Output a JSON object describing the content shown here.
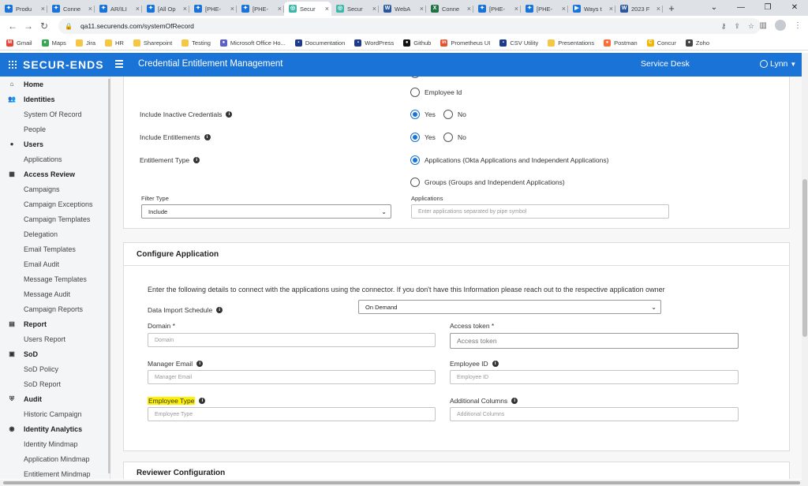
{
  "browser": {
    "tabs": [
      {
        "title": "Produ",
        "color": "#1a73d6",
        "glyph": "✦",
        "icon": "jira-icon"
      },
      {
        "title": "Conne",
        "color": "#1a73d6",
        "glyph": "✦",
        "icon": "jira-icon"
      },
      {
        "title": "AR/ILI",
        "color": "#1a73d6",
        "glyph": "✦",
        "icon": "jira-icon"
      },
      {
        "title": "[All Op",
        "color": "#1a73d6",
        "glyph": "✦",
        "icon": "jira-icon"
      },
      {
        "title": "[PHE-",
        "color": "#1a73d6",
        "glyph": "✦",
        "icon": "jira-icon"
      },
      {
        "title": "[PHE-",
        "color": "#1a73d6",
        "glyph": "✦",
        "icon": "jira-icon"
      },
      {
        "title": "Secur",
        "color": "#3fb6a8",
        "glyph": "◎",
        "icon": "securends-icon",
        "active": true
      },
      {
        "title": "Secur",
        "color": "#3fb6a8",
        "glyph": "◎",
        "icon": "securends-icon"
      },
      {
        "title": "WebA",
        "color": "#2b579a",
        "glyph": "W",
        "icon": "word-icon"
      },
      {
        "title": "Conne",
        "color": "#217346",
        "glyph": "X",
        "icon": "excel-icon"
      },
      {
        "title": "[PHE-",
        "color": "#1a73d6",
        "glyph": "✦",
        "icon": "jira-icon"
      },
      {
        "title": "[PHE-",
        "color": "#1a73d6",
        "glyph": "✦",
        "icon": "jira-icon"
      },
      {
        "title": "Ways t",
        "color": "#1a73d6",
        "glyph": "▶",
        "icon": "play-icon"
      },
      {
        "title": "2023 F",
        "color": "#2b579a",
        "glyph": "W",
        "icon": "word-icon"
      }
    ],
    "url": "qa11.securends.com/systemOfRecord",
    "bookmarks": [
      {
        "label": "Gmail",
        "color": "#ea4335",
        "glyph": "M",
        "icon": "gmail-icon"
      },
      {
        "label": "Maps",
        "color": "#34a853",
        "glyph": "●",
        "icon": "maps-icon"
      },
      {
        "label": "Jira",
        "color": "#f6c744",
        "glyph": "",
        "icon": "folder-icon"
      },
      {
        "label": "HR",
        "color": "#f6c744",
        "glyph": "",
        "icon": "folder-icon"
      },
      {
        "label": "Sharepoint",
        "color": "#f6c744",
        "glyph": "",
        "icon": "folder-icon"
      },
      {
        "label": "Testing",
        "color": "#f6c744",
        "glyph": "",
        "icon": "folder-icon"
      },
      {
        "label": "Microsoft Office Ho...",
        "color": "#5b5fc7",
        "glyph": "●",
        "icon": "office-icon"
      },
      {
        "label": "Documentation",
        "color": "#1e3a8a",
        "glyph": "▪",
        "icon": "doc-icon"
      },
      {
        "label": "WordPress",
        "color": "#1e3a8a",
        "glyph": "▪",
        "icon": "wordpress-icon"
      },
      {
        "label": "Github",
        "color": "#111111",
        "glyph": "●",
        "icon": "github-icon"
      },
      {
        "label": "Prometheus UI",
        "color": "#e6522c",
        "glyph": "in",
        "icon": "prometheus-icon"
      },
      {
        "label": "CSV Utility",
        "color": "#1e3a8a",
        "glyph": "▪",
        "icon": "csv-icon"
      },
      {
        "label": "Presentations",
        "color": "#f6c744",
        "glyph": "",
        "icon": "folder-icon"
      },
      {
        "label": "Postman",
        "color": "#ff6c37",
        "glyph": "●",
        "icon": "postman-icon"
      },
      {
        "label": "Concur",
        "color": "#f2b705",
        "glyph": "C",
        "icon": "concur-icon"
      },
      {
        "label": "Zoho",
        "color": "#444444",
        "glyph": "●",
        "icon": "zoho-icon"
      }
    ]
  },
  "header": {
    "brand": "SECUR-ENDS",
    "title": "Credential Entitlement Management",
    "service_desk": "Service Desk",
    "user": "Lynn"
  },
  "sidebar": {
    "items": [
      {
        "label": "Home",
        "type": "section",
        "icon": "home-icon",
        "glyph": "⌂"
      },
      {
        "label": "Identities",
        "type": "section",
        "icon": "identities-icon",
        "glyph": "👥"
      },
      {
        "label": "System Of Record",
        "type": "child"
      },
      {
        "label": "People",
        "type": "child"
      },
      {
        "label": "Users",
        "type": "section",
        "icon": "user-icon",
        "glyph": "●"
      },
      {
        "label": "Applications",
        "type": "child"
      },
      {
        "label": "Access Review",
        "type": "section",
        "icon": "grid-icon",
        "glyph": "▦"
      },
      {
        "label": "Campaigns",
        "type": "child"
      },
      {
        "label": "Campaign Exceptions",
        "type": "child"
      },
      {
        "label": "Campaign Templates",
        "type": "child"
      },
      {
        "label": "Delegation",
        "type": "child"
      },
      {
        "label": "Email Templates",
        "type": "child"
      },
      {
        "label": "Email Audit",
        "type": "child"
      },
      {
        "label": "Message Templates",
        "type": "child"
      },
      {
        "label": "Message Audit",
        "type": "child"
      },
      {
        "label": "Campaign Reports",
        "type": "child"
      },
      {
        "label": "Report",
        "type": "section",
        "icon": "report-icon",
        "glyph": "▤"
      },
      {
        "label": "Users Report",
        "type": "child"
      },
      {
        "label": "SoD",
        "type": "section",
        "icon": "sod-icon",
        "glyph": "▣"
      },
      {
        "label": "SoD Policy",
        "type": "child"
      },
      {
        "label": "SoD Report",
        "type": "child"
      },
      {
        "label": "Audit",
        "type": "section",
        "icon": "shield-icon",
        "glyph": "⛨"
      },
      {
        "label": "Historic Campaign",
        "type": "child"
      },
      {
        "label": "Identity Analytics",
        "type": "section",
        "icon": "analytics-icon",
        "glyph": "◉"
      },
      {
        "label": "Identity Mindmap",
        "type": "child"
      },
      {
        "label": "Application Mindmap",
        "type": "child"
      },
      {
        "label": "Entitlement Mindmap",
        "type": "child"
      }
    ]
  },
  "options": {
    "employee_id": "Employee Id",
    "inactive_label": "Include Inactive Credentials",
    "entitlements_label": "Include Entitlements",
    "entitlement_type_label": "Entitlement Type",
    "yes": "Yes",
    "no": "No",
    "ent_apps": "Applications (Okta Applications and Independent Applications)",
    "ent_groups": "Groups (Groups and Independent Applications)",
    "filter_type_label": "Filter Type",
    "filter_type_value": "Include",
    "applications_label": "Applications",
    "applications_placeholder": "Enter applications separated by pipe symbol"
  },
  "configure": {
    "title": "Configure Application",
    "intro": "Enter the following details to connect with the applications using the connector. If you don't have this Information please reach out to the respective application owner",
    "schedule_label": "Data Import Schedule",
    "schedule_value": "On Demand",
    "domain_label": "Domain *",
    "domain_placeholder": "Domain",
    "token_label": "Access token *",
    "token_placeholder": "Access token",
    "manager_label": "Manager Email",
    "manager_placeholder": "Manager Email",
    "empid_label": "Employee ID",
    "empid_placeholder": "Employee ID",
    "emptype_label": "Employee Type",
    "emptype_placeholder": "Employee Type",
    "addcols_label": "Additional Columns",
    "addcols_placeholder": "Additional Columns"
  },
  "reviewer": {
    "title": "Reviewer Configuration"
  }
}
